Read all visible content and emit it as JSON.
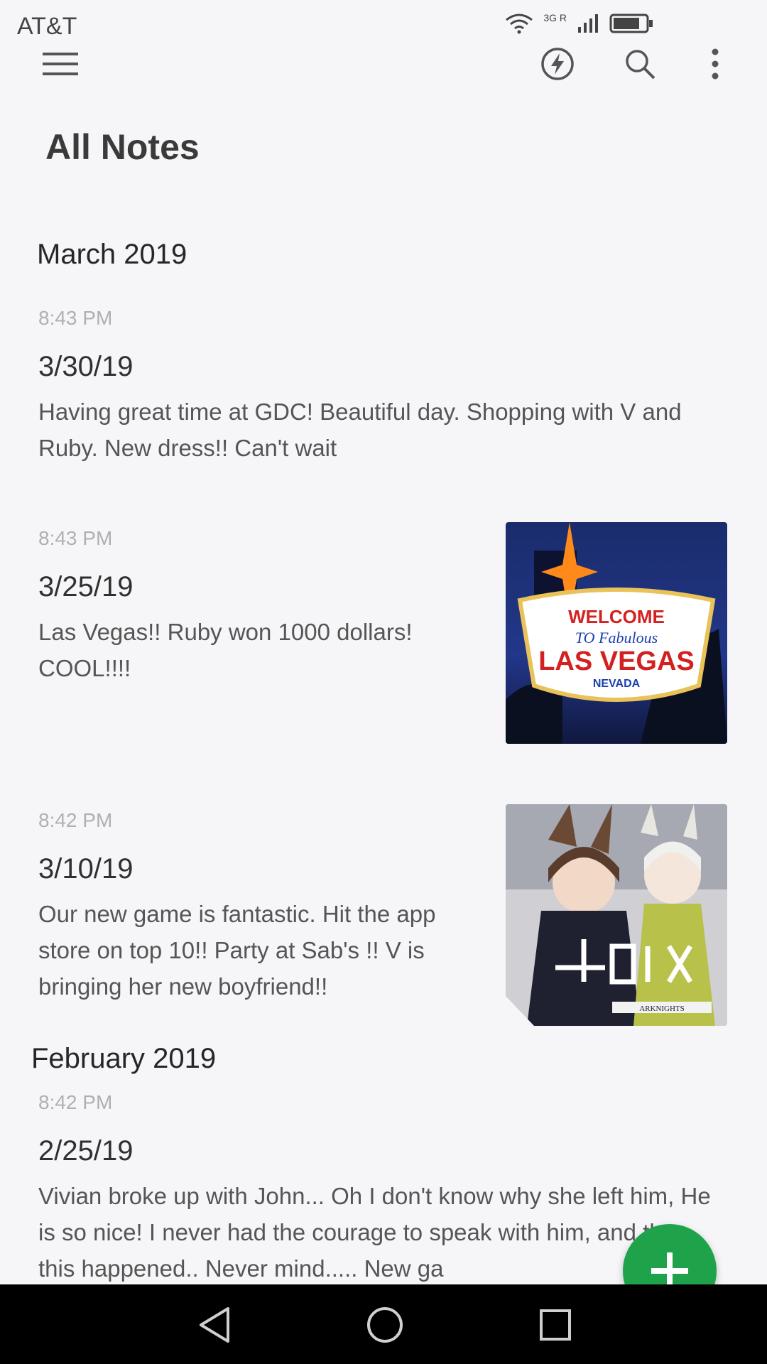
{
  "status": {
    "carrier": "AT&T",
    "network": "3G R"
  },
  "app": {
    "title": "All Notes"
  },
  "sections": [
    {
      "month": "March 2019",
      "notes": [
        {
          "time": "8:43 PM",
          "date": "3/30/19",
          "text": "Having great time at GDC!  Beautiful day. Shopping with V and Ruby. New dress!! Can't wait"
        },
        {
          "time": "8:43 PM",
          "date": "3/25/19",
          "text": "Las Vegas!! Ruby won 1000 dollars! COOL!!!!",
          "thumb": {
            "line1": "WELCOME",
            "line2": "TO Fabulous",
            "line3": "LAS VEGAS",
            "line4": "NEVADA"
          }
        },
        {
          "time": "8:42 PM",
          "date": "3/10/19",
          "text": "Our new game is fantastic. Hit the app store on top 10!!  Party at Sab's !! V is bringing her new boyfriend!!",
          "thumb": {
            "caption": "ARKNIGHTS"
          }
        }
      ]
    },
    {
      "month": "February 2019",
      "notes": [
        {
          "time": "8:42 PM",
          "date": "2/25/19",
          "text": "Vivian broke up with John... Oh I don't know why she left him, He is so nice!  I never had the courage to speak with him, and then this happened.. Never mind..... New ga"
        }
      ]
    }
  ],
  "colors": {
    "accent": "#1ea34a",
    "background": "#f6f6f8"
  },
  "icons": {
    "menu": "hamburger-icon",
    "bolt": "lightning-icon",
    "search": "search-icon",
    "more": "more-vert-icon",
    "fab": "plus-icon"
  }
}
